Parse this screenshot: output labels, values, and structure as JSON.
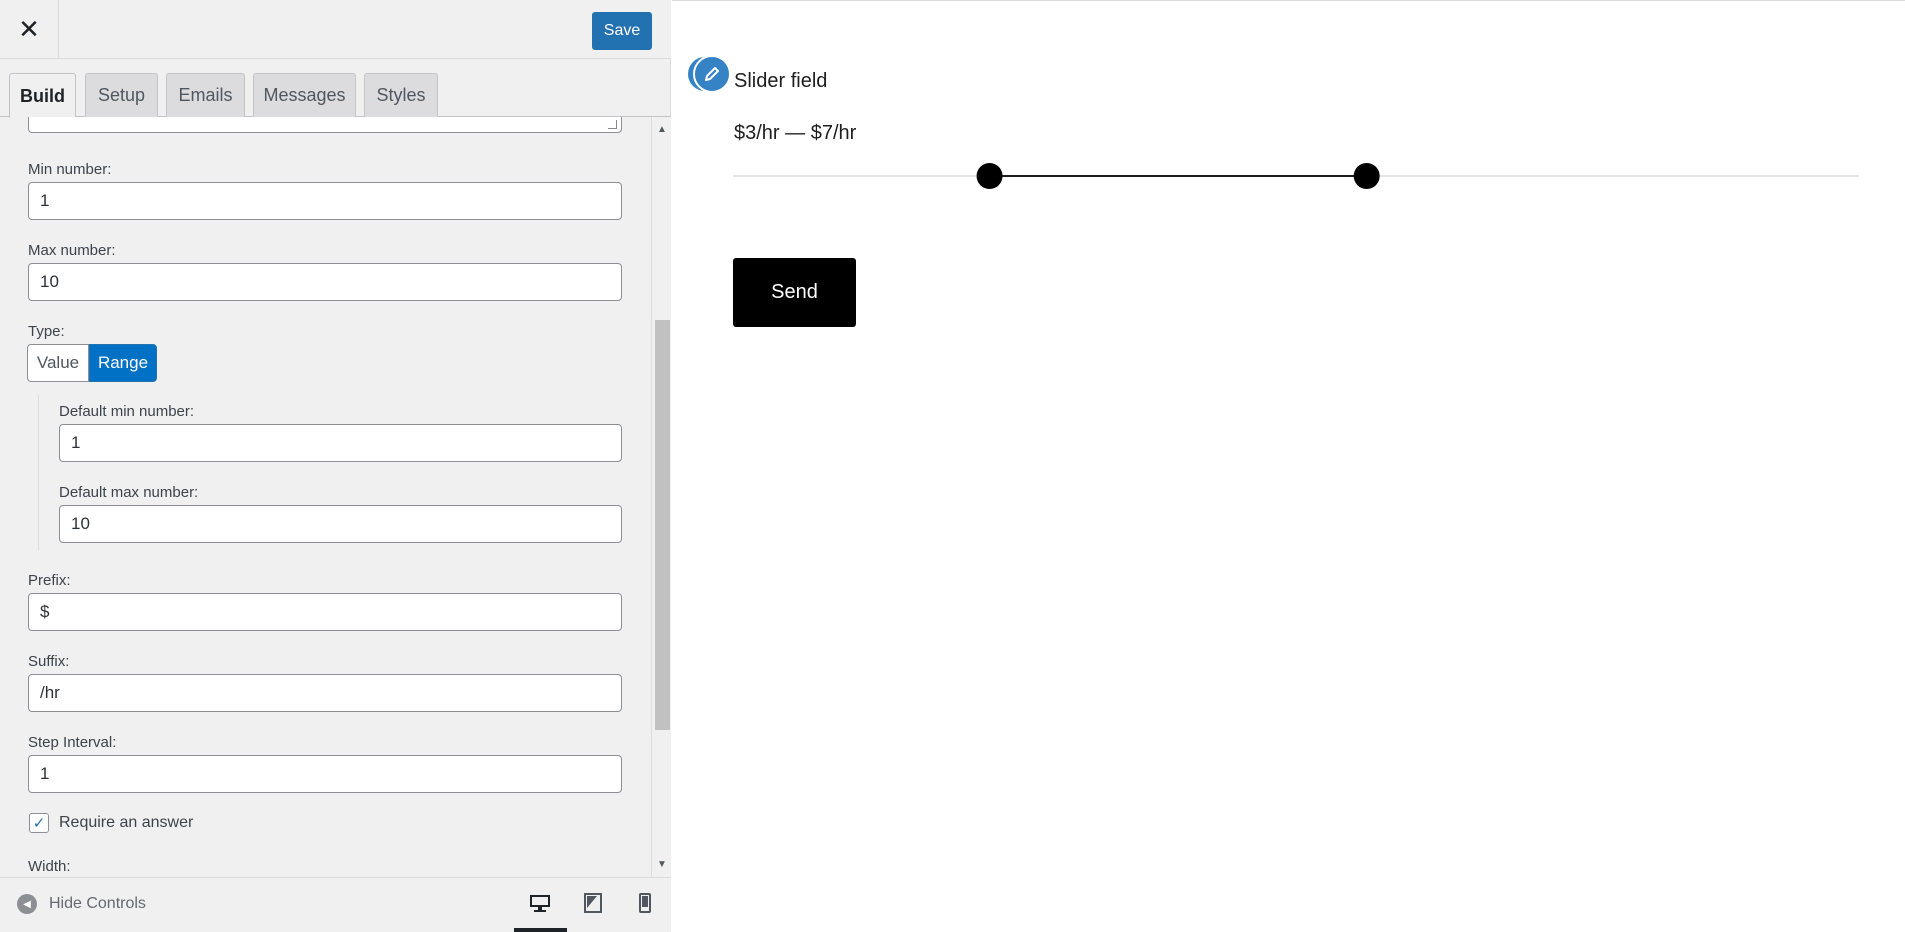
{
  "header": {
    "close_glyph": "✕",
    "save_label": "Save"
  },
  "tabs": [
    {
      "label": "Build",
      "active": true
    },
    {
      "label": "Setup",
      "active": false
    },
    {
      "label": "Emails",
      "active": false
    },
    {
      "label": "Messages",
      "active": false
    },
    {
      "label": "Styles",
      "active": false
    }
  ],
  "controls": {
    "min_number": {
      "label": "Min number:",
      "value": "1"
    },
    "max_number": {
      "label": "Max number:",
      "value": "10"
    },
    "type": {
      "label": "Type:",
      "options": [
        "Value",
        "Range"
      ],
      "selected": "Range"
    },
    "default_min": {
      "label": "Default min number:",
      "value": "1"
    },
    "default_max": {
      "label": "Default max number:",
      "value": "10"
    },
    "prefix": {
      "label": "Prefix:",
      "value": "$"
    },
    "suffix": {
      "label": "Suffix:",
      "value": "/hr"
    },
    "step": {
      "label": "Step Interval:",
      "value": "1"
    },
    "require": {
      "label": "Require an answer",
      "checked": true,
      "check_glyph": "✓"
    },
    "width": {
      "label": "Width:"
    }
  },
  "footer": {
    "hide_label": "Hide Controls",
    "devices": [
      "desktop-icon",
      "tablet-icon",
      "mobile-icon"
    ],
    "active_device": "desktop"
  },
  "preview": {
    "field_title": "Slider field",
    "range_text": "$3/hr — $7/hr",
    "slider": {
      "min": 1,
      "max": 10,
      "low": 3,
      "high": 7
    },
    "send_label": "Send"
  },
  "colors": {
    "accent": "#2271b1",
    "segment_active": "#0071c5",
    "panel_bg": "#f0f0f1",
    "button_dark": "#000000"
  }
}
